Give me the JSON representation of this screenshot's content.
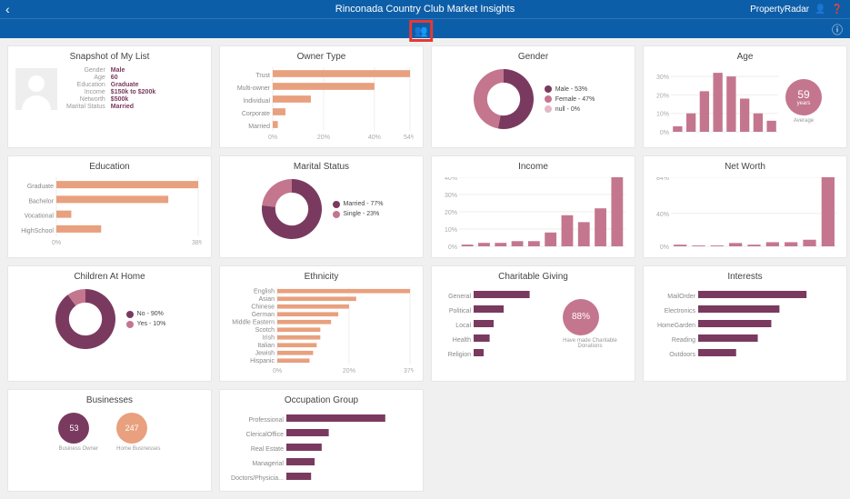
{
  "header": {
    "title": "Rinconada Country Club Market Insights",
    "brand": "PropertyRadar"
  },
  "colors": {
    "purple": "#7a3a5f",
    "coral": "#e8a07e",
    "pink": "#c4768f",
    "lightpink": "#e4b8c8"
  },
  "snapshot": {
    "title": "Snapshot of My List",
    "rows": [
      {
        "k": "Gender",
        "v": "Male"
      },
      {
        "k": "Age",
        "v": "60"
      },
      {
        "k": "Education",
        "v": "Graduate"
      },
      {
        "k": "Income",
        "v": "$150k to $200k"
      },
      {
        "k": "Networth",
        "v": "$500k"
      },
      {
        "k": "Marital Status",
        "v": "Married"
      }
    ]
  },
  "chart_data": [
    {
      "id": "owner",
      "type": "bar",
      "orientation": "h",
      "title": "Owner Type",
      "categories": [
        "Trust",
        "Multi-owner",
        "Individual",
        "Corporate",
        "Married"
      ],
      "values": [
        54,
        40,
        15,
        5,
        2
      ],
      "xticks": [
        "0%",
        "20%",
        "40%",
        "54%"
      ],
      "xlim": [
        0,
        54
      ],
      "color": "coral"
    },
    {
      "id": "gender",
      "type": "donut",
      "title": "Gender",
      "series": [
        {
          "name": "Male",
          "value": 53,
          "color": "purple"
        },
        {
          "name": "Female",
          "value": 47,
          "color": "pink"
        },
        {
          "name": "null",
          "value": 0,
          "color": "lightpink"
        }
      ],
      "legend": [
        "Male - 53%",
        "Female - 47%",
        "null - 0%"
      ]
    },
    {
      "id": "age",
      "type": "bar",
      "orientation": "v",
      "title": "Age",
      "categories": [
        "",
        "",
        "",
        "",
        "",
        "",
        "",
        ""
      ],
      "values": [
        3,
        10,
        22,
        32,
        30,
        18,
        10,
        6
      ],
      "yticks": [
        "0%",
        "10%",
        "20%",
        "30%"
      ],
      "ylim": [
        0,
        35
      ],
      "color": "pink",
      "badge": {
        "value": "59",
        "unit": "years",
        "label": "Average",
        "color": "pink"
      }
    },
    {
      "id": "education",
      "type": "bar",
      "orientation": "h",
      "title": "Education",
      "categories": [
        "Graduate",
        "Bachelor",
        "Vocational",
        "HighSchool"
      ],
      "values": [
        38,
        30,
        4,
        12
      ],
      "xticks": [
        "0%",
        "38%"
      ],
      "xlim": [
        0,
        38
      ],
      "color": "coral"
    },
    {
      "id": "marital",
      "type": "donut",
      "title": "Marital Status",
      "series": [
        {
          "name": "Married",
          "value": 77,
          "color": "purple"
        },
        {
          "name": "Single",
          "value": 23,
          "color": "pink"
        }
      ],
      "legend": [
        "Married - 77%",
        "Single - 23%"
      ]
    },
    {
      "id": "income",
      "type": "bar",
      "orientation": "v",
      "title": "Income",
      "categories": [
        "",
        "",
        "",
        "",
        "",
        "",
        "",
        "",
        "",
        ""
      ],
      "values": [
        1,
        2,
        2,
        3,
        3,
        8,
        18,
        14,
        22,
        40
      ],
      "yticks": [
        "0%",
        "10%",
        "20%",
        "30%",
        "40%"
      ],
      "ylim": [
        0,
        40
      ],
      "color": "pink"
    },
    {
      "id": "networth",
      "type": "bar",
      "orientation": "v",
      "title": "Net Worth",
      "categories": [
        "",
        "",
        "",
        "",
        "",
        "",
        "",
        "",
        ""
      ],
      "values": [
        2,
        1,
        1,
        4,
        2,
        5,
        5,
        8,
        84
      ],
      "yticks": [
        "0%",
        "40%",
        "84%"
      ],
      "ylim": [
        0,
        84
      ],
      "color": "pink"
    },
    {
      "id": "children",
      "type": "donut",
      "title": "Children At Home",
      "series": [
        {
          "name": "No",
          "value": 90,
          "color": "purple"
        },
        {
          "name": "Yes",
          "value": 10,
          "color": "pink"
        }
      ],
      "legend": [
        "No - 90%",
        "Yes - 10%"
      ]
    },
    {
      "id": "ethnicity",
      "type": "bar",
      "orientation": "h",
      "title": "Ethnicity",
      "categories": [
        "English",
        "Asian",
        "Chinese",
        "German",
        "Middle Eastern",
        "Scotch",
        "Irish",
        "Italian",
        "Jewish",
        "Hispanic"
      ],
      "values": [
        37,
        22,
        20,
        17,
        15,
        12,
        12,
        11,
        10,
        9
      ],
      "xticks": [
        "0%",
        "20%",
        "37%"
      ],
      "xlim": [
        0,
        37
      ],
      "color": "coral"
    },
    {
      "id": "charitable",
      "type": "bar",
      "orientation": "h",
      "title": "Charitable Giving",
      "categories": [
        "General",
        "Political",
        "Local",
        "Health",
        "Religion"
      ],
      "values": [
        28,
        15,
        10,
        8,
        5
      ],
      "xlim": [
        0,
        40
      ],
      "color": "purple",
      "badge": {
        "value": "88%",
        "label": "Have made Charitable Donations",
        "color": "pink"
      }
    },
    {
      "id": "interests",
      "type": "bar",
      "orientation": "h",
      "title": "Interests",
      "categories": [
        "MailOrder",
        "Electronics",
        "HomeGarden",
        "Reading",
        "Outdoors"
      ],
      "values": [
        40,
        30,
        27,
        22,
        14
      ],
      "xlim": [
        0,
        50
      ],
      "color": "purple"
    },
    {
      "id": "businesses",
      "type": "badges",
      "title": "Businesses",
      "badges": [
        {
          "value": "53",
          "label": "Business Owner",
          "color": "purple"
        },
        {
          "value": "247",
          "label": "Home Businesses",
          "color": "coral"
        }
      ]
    },
    {
      "id": "occupation",
      "type": "bar",
      "orientation": "h",
      "title": "Occupation Group",
      "categories": [
        "Professional",
        "ClericalOffice",
        "Real Estate",
        "Managerial",
        "Doctors/Physicia..."
      ],
      "values": [
        28,
        12,
        10,
        8,
        7
      ],
      "xlim": [
        0,
        35
      ],
      "color": "purple"
    }
  ]
}
